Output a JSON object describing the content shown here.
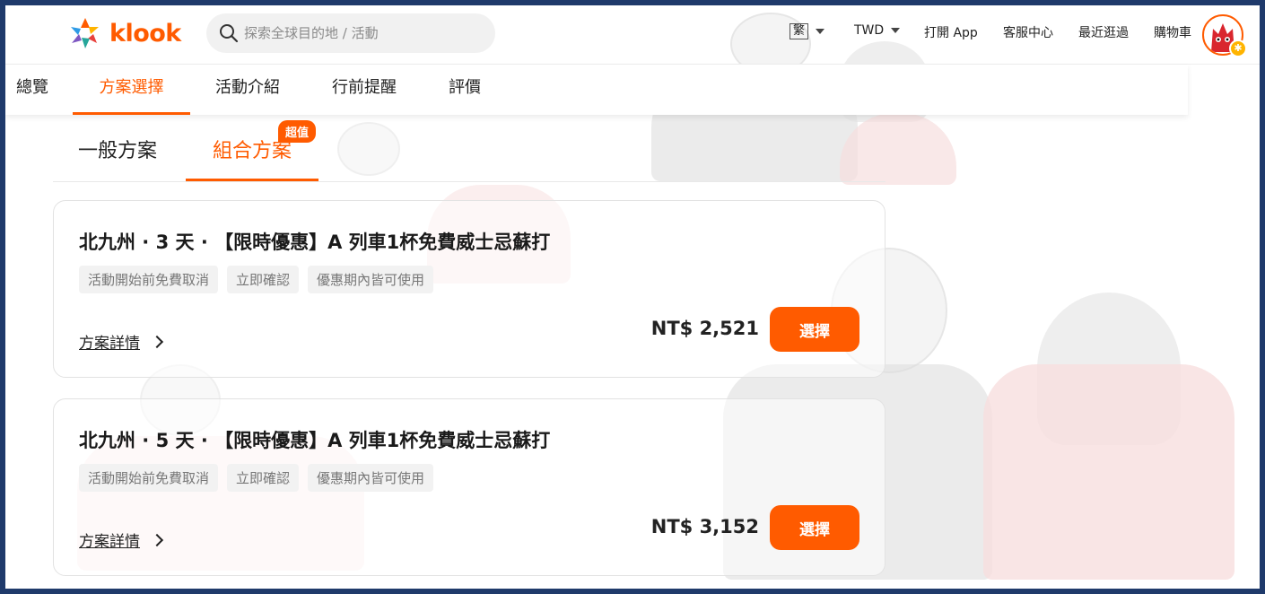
{
  "header": {
    "brand": "klook",
    "search_placeholder": "探索全球目的地 / 活動",
    "language": "繁",
    "currency": "TWD",
    "open_app": "打開 App",
    "customer_service": "客服中心",
    "recently_viewed": "最近逛過",
    "cart": "購物車"
  },
  "section_tabs": [
    {
      "label": "總覽"
    },
    {
      "label": "方案選擇"
    },
    {
      "label": "活動介紹"
    },
    {
      "label": "行前提醒"
    },
    {
      "label": "評價"
    }
  ],
  "package_tabs": {
    "general": "一般方案",
    "combo": "組合方案",
    "combo_badge": "超值"
  },
  "packages": [
    {
      "title": "北九州 · 3 天 · 【限時優惠】A 列車1杯免費威士忌蘇打",
      "tags": [
        "活動開始前免費取消",
        "立即確認",
        "優惠期內皆可使用"
      ],
      "details_label": "方案詳情",
      "price": "NT$ 2,521",
      "select_label": "選擇"
    },
    {
      "title": "北九州 · 5 天 · 【限時優惠】A 列車1杯免費威士忌蘇打",
      "tags": [
        "活動開始前免費取消",
        "立即確認",
        "優惠期內皆可使用"
      ],
      "details_label": "方案詳情",
      "price": "NT$ 3,152",
      "select_label": "選擇"
    }
  ],
  "colors": {
    "accent": "#ff5b00",
    "frame": "#1f3a6b"
  }
}
